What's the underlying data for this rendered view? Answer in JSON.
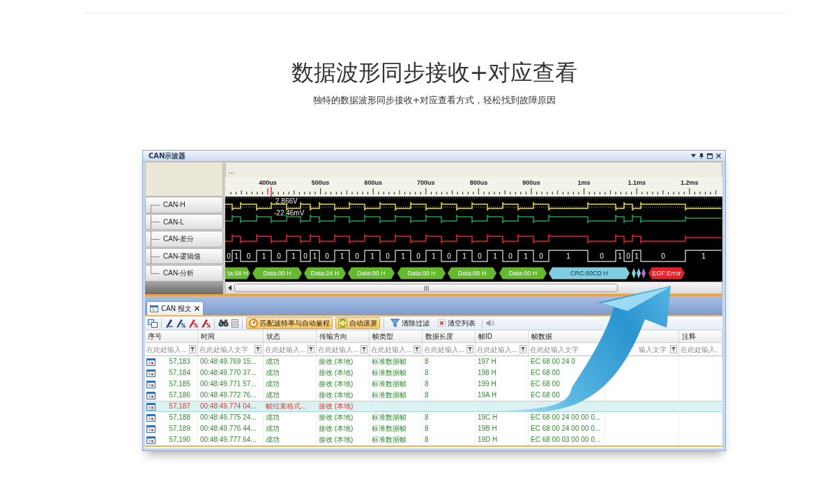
{
  "page": {
    "title": "数据波形同步接收+对应查看",
    "subtitle": "独特的数据波形同步接收+对应查看方式，轻松找到故障原因"
  },
  "window": {
    "title": "CAN示波器"
  },
  "scope": {
    "strip_text": "...",
    "time_ticks": [
      "400us",
      "500us",
      "600us",
      "700us",
      "800us",
      "900us",
      "1ms",
      "1.1ms",
      "1.2ms"
    ],
    "readouts": [
      "2.866V",
      "-22.46mV"
    ],
    "channels": [
      {
        "name": "CAN-H",
        "kind": "analog",
        "color": "#e8dc3c"
      },
      {
        "name": "CAN-L",
        "kind": "analog",
        "color": "#1fa34a"
      },
      {
        "name": "CAN-差分",
        "kind": "analog",
        "color": "#e3232a"
      },
      {
        "name": "CAN-逻辑值",
        "kind": "logic",
        "bits": [
          "0",
          "1",
          "0",
          "1",
          "0",
          "1",
          "0",
          "1",
          "0",
          "1",
          "0",
          "1",
          "0",
          "1",
          "0",
          "1",
          "0",
          "1",
          "0",
          "1",
          "0",
          "1",
          "0",
          "1",
          "0",
          "1",
          "0",
          "1",
          "0",
          "1"
        ]
      },
      {
        "name": "CAN-分析",
        "kind": "decode",
        "segments": [
          {
            "kind": "data",
            "label": "ta:68 H",
            "color": "#66b82e"
          },
          {
            "kind": "data",
            "label": "Data:00 H",
            "color": "#66b82e"
          },
          {
            "kind": "data",
            "label": "Data:24 H",
            "color": "#66b82e"
          },
          {
            "kind": "data",
            "label": "Data:00 H",
            "color": "#66b82e"
          },
          {
            "kind": "data",
            "label": "Data:00 H",
            "color": "#66b82e"
          },
          {
            "kind": "data",
            "label": "Data:00 H",
            "color": "#66b82e"
          },
          {
            "kind": "data",
            "label": "Data:00 H",
            "color": "#66b82e"
          },
          {
            "kind": "crc",
            "label": "CRC:60CD H",
            "color": "#7fcde0"
          },
          {
            "kind": "marker",
            "color": "#7fcde0"
          },
          {
            "kind": "marker",
            "color": "#7fcde0"
          },
          {
            "kind": "marker",
            "color": "#b070d0"
          },
          {
            "kind": "error",
            "label": "EOF:Error",
            "color": "#e8202a"
          }
        ]
      }
    ]
  },
  "message_panel": {
    "tabs": [
      {
        "label": "CAN 报文",
        "selected": true
      }
    ],
    "toolbar": [
      {
        "label": "匹配波特率与自动量程",
        "on": true
      },
      {
        "label": "自动滚屏",
        "on": true
      },
      {
        "label": "清除过滤",
        "on": false
      },
      {
        "label": "清空列表",
        "on": false
      }
    ],
    "table": {
      "columns": [
        {
          "label": "序号",
          "placeholder": "在此处输入...",
          "filter_icon": true
        },
        {
          "label": "时间",
          "placeholder": "在此处输入文字",
          "filter_icon": true
        },
        {
          "label": "状态",
          "placeholder": "在此处输入...",
          "filter_icon": true
        },
        {
          "label": "传输方向",
          "placeholder": "在此处输入...",
          "filter_icon": true
        },
        {
          "label": "帧类型",
          "placeholder": "在此处输入...",
          "filter_icon": true
        },
        {
          "label": "数据长度",
          "placeholder": "在此处输入...",
          "filter_icon": true
        },
        {
          "label": "帧ID",
          "placeholder": "在此处输入...",
          "filter_icon": true
        },
        {
          "label": "帧数据",
          "placeholder": "在此处输入文字",
          "filter_icon": false
        },
        {
          "placeholder": "输入文字",
          "filter_icon": true
        },
        {
          "label": "注释",
          "placeholder": "在此处输入.",
          "filter_icon": false
        }
      ],
      "rows": [
        {
          "cells": [
            "57,183",
            "00:48:49.769 15...",
            "成功",
            "接收 (本地)",
            "标准数据帧",
            "8",
            "197 H",
            "EC 68 00 24 0"
          ],
          "selected": false,
          "error": false
        },
        {
          "cells": [
            "57,184",
            "00:48:49.770 37...",
            "成功",
            "接收 (本地)",
            "标准数据帧",
            "8",
            "198 H",
            "EC 68 00"
          ],
          "selected": false,
          "error": false
        },
        {
          "cells": [
            "57,185",
            "00:48:49.771 57...",
            "成功",
            "接收 (本地)",
            "标准数据帧",
            "8",
            "199 H",
            "EC 68 00"
          ],
          "selected": false,
          "error": false
        },
        {
          "cells": [
            "57,186",
            "00:48:49.772 76...",
            "成功",
            "接收 (本地)",
            "标准数据帧",
            "8",
            "19A H",
            "EC 68 00"
          ],
          "selected": false,
          "error": false
        },
        {
          "cells": [
            "57,187",
            "00:48:49.774 04...",
            "帧结束格式...",
            "接收 (本地)"
          ],
          "selected": true,
          "error": true
        },
        {
          "cells": [
            "57,188",
            "00:48:49.775 24...",
            "成功",
            "接收 (本地)",
            "标准数据帧",
            "8",
            "19C H",
            "EC 68 00 24 00 00 0..."
          ],
          "selected": false,
          "error": false
        },
        {
          "cells": [
            "57,189",
            "00:48:49.776 44...",
            "成功",
            "接收 (本地)",
            "标准数据帧",
            "8",
            "19B H",
            "EC 68 00 24 00 00 0..."
          ],
          "selected": false,
          "error": false
        },
        {
          "cells": [
            "57,190",
            "00:48:49.777 64...",
            "成功",
            "接收 (本地)",
            "标准数据帧",
            "8",
            "19D H",
            "EC 68 00 03 00 00 0..."
          ],
          "selected": false,
          "error": false
        }
      ]
    }
  }
}
